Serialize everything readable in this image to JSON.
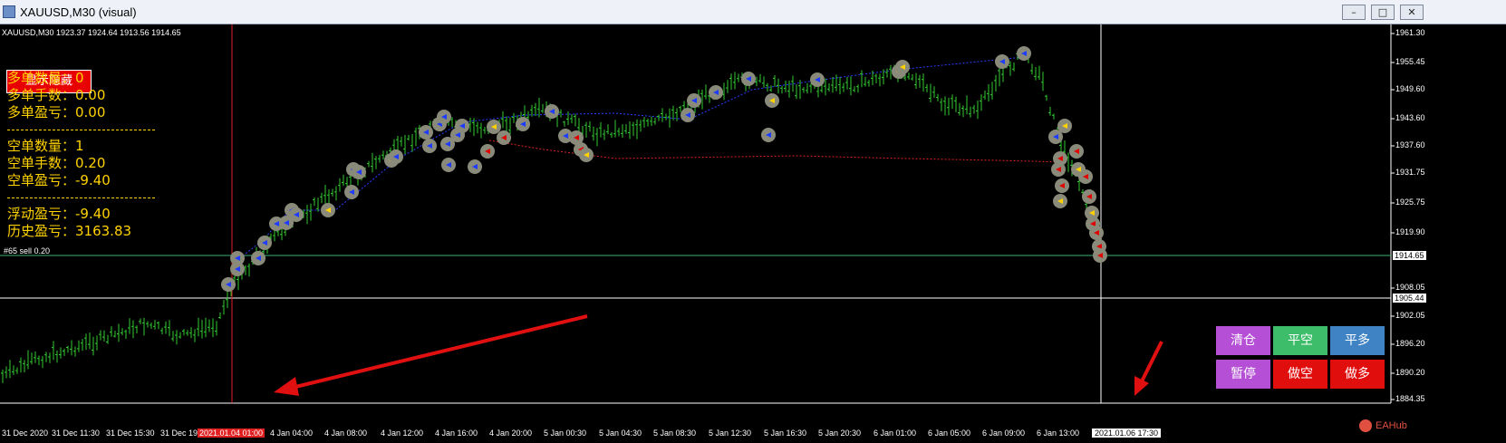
{
  "window": {
    "title": "XAUUSD,M30 (visual)",
    "controls": [
      "–",
      "□",
      "✕"
    ]
  },
  "chart": {
    "ohlc_header": "XAUUSD,M30 1923.37 1924.64 1913.56 1914.65",
    "current_price": "1914.65",
    "subwindow_value": "1905.44",
    "trade_label": "#65 sell 0.20",
    "price_axis": [
      "1961.30",
      "1955.45",
      "1949.60",
      "1943.60",
      "1937.60",
      "1931.75",
      "1925.75",
      "1919.90",
      "1908.05",
      "1902.05",
      "1896.20",
      "1890.20",
      "1884.35"
    ],
    "time_axis": [
      "31 Dec 2020",
      "31 Dec 11:30",
      "31 Dec 15:30",
      "31 Dec 19:30",
      "4 Jan 04:00",
      "4 Jan 08:00",
      "4 Jan 12:00",
      "4 Jan 16:00",
      "4 Jan 20:00",
      "5 Jan 00:30",
      "5 Jan 04:30",
      "5 Jan 08:30",
      "5 Jan 12:30",
      "5 Jan 16:30",
      "5 Jan 20:30",
      "6 Jan 01:00",
      "6 Jan 05:00",
      "6 Jan 09:00",
      "6 Jan 13:00"
    ],
    "highlight_time_start": "2021.01.04 01:00",
    "highlight_time_cursor": "2021.01.06 17:30",
    "colors": {
      "background": "#000000",
      "candles": "#32cd32",
      "buy_marker": "#1e3cff",
      "sell_marker": "#e00000",
      "panel_text": "#ffd200",
      "arrows": "#e01010"
    }
  },
  "panel": {
    "toggle_label": "显示隐藏",
    "long_count": "多单数量：0",
    "long_lots": "多单手数：0.00",
    "long_pnl": "多单盈亏：0.00",
    "short_count": "空单数量：1",
    "short_lots": "空单手数：0.20",
    "short_pnl": "空单盈亏：-9.40",
    "floating_pnl": "浮动盈亏：-9.40",
    "history_pnl": "历史盈亏：3163.83"
  },
  "actions": {
    "clear": "清仓",
    "close_short": "平空",
    "close_long": "平多",
    "pause": "暂停",
    "sell": "做空",
    "buy": "做多"
  },
  "watermark": "EAHub"
}
